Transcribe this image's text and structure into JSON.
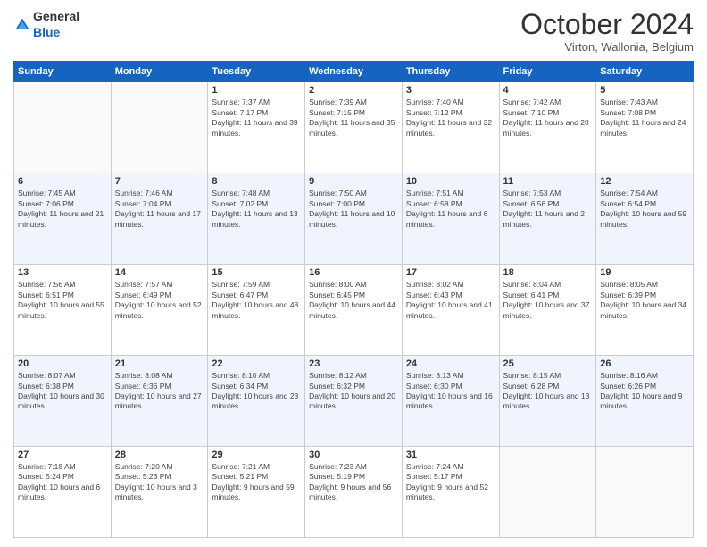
{
  "logo": {
    "text_general": "General",
    "text_blue": "Blue"
  },
  "header": {
    "month": "October 2024",
    "location": "Virton, Wallonia, Belgium"
  },
  "weekdays": [
    "Sunday",
    "Monday",
    "Tuesday",
    "Wednesday",
    "Thursday",
    "Friday",
    "Saturday"
  ],
  "weeks": [
    [
      {
        "day": "",
        "sunrise": "",
        "sunset": "",
        "daylight": ""
      },
      {
        "day": "",
        "sunrise": "",
        "sunset": "",
        "daylight": ""
      },
      {
        "day": "1",
        "sunrise": "Sunrise: 7:37 AM",
        "sunset": "Sunset: 7:17 PM",
        "daylight": "Daylight: 11 hours and 39 minutes."
      },
      {
        "day": "2",
        "sunrise": "Sunrise: 7:39 AM",
        "sunset": "Sunset: 7:15 PM",
        "daylight": "Daylight: 11 hours and 35 minutes."
      },
      {
        "day": "3",
        "sunrise": "Sunrise: 7:40 AM",
        "sunset": "Sunset: 7:12 PM",
        "daylight": "Daylight: 11 hours and 32 minutes."
      },
      {
        "day": "4",
        "sunrise": "Sunrise: 7:42 AM",
        "sunset": "Sunset: 7:10 PM",
        "daylight": "Daylight: 11 hours and 28 minutes."
      },
      {
        "day": "5",
        "sunrise": "Sunrise: 7:43 AM",
        "sunset": "Sunset: 7:08 PM",
        "daylight": "Daylight: 11 hours and 24 minutes."
      }
    ],
    [
      {
        "day": "6",
        "sunrise": "Sunrise: 7:45 AM",
        "sunset": "Sunset: 7:06 PM",
        "daylight": "Daylight: 11 hours and 21 minutes."
      },
      {
        "day": "7",
        "sunrise": "Sunrise: 7:46 AM",
        "sunset": "Sunset: 7:04 PM",
        "daylight": "Daylight: 11 hours and 17 minutes."
      },
      {
        "day": "8",
        "sunrise": "Sunrise: 7:48 AM",
        "sunset": "Sunset: 7:02 PM",
        "daylight": "Daylight: 11 hours and 13 minutes."
      },
      {
        "day": "9",
        "sunrise": "Sunrise: 7:50 AM",
        "sunset": "Sunset: 7:00 PM",
        "daylight": "Daylight: 11 hours and 10 minutes."
      },
      {
        "day": "10",
        "sunrise": "Sunrise: 7:51 AM",
        "sunset": "Sunset: 6:58 PM",
        "daylight": "Daylight: 11 hours and 6 minutes."
      },
      {
        "day": "11",
        "sunrise": "Sunrise: 7:53 AM",
        "sunset": "Sunset: 6:56 PM",
        "daylight": "Daylight: 11 hours and 2 minutes."
      },
      {
        "day": "12",
        "sunrise": "Sunrise: 7:54 AM",
        "sunset": "Sunset: 6:54 PM",
        "daylight": "Daylight: 10 hours and 59 minutes."
      }
    ],
    [
      {
        "day": "13",
        "sunrise": "Sunrise: 7:56 AM",
        "sunset": "Sunset: 6:51 PM",
        "daylight": "Daylight: 10 hours and 55 minutes."
      },
      {
        "day": "14",
        "sunrise": "Sunrise: 7:57 AM",
        "sunset": "Sunset: 6:49 PM",
        "daylight": "Daylight: 10 hours and 52 minutes."
      },
      {
        "day": "15",
        "sunrise": "Sunrise: 7:59 AM",
        "sunset": "Sunset: 6:47 PM",
        "daylight": "Daylight: 10 hours and 48 minutes."
      },
      {
        "day": "16",
        "sunrise": "Sunrise: 8:00 AM",
        "sunset": "Sunset: 6:45 PM",
        "daylight": "Daylight: 10 hours and 44 minutes."
      },
      {
        "day": "17",
        "sunrise": "Sunrise: 8:02 AM",
        "sunset": "Sunset: 6:43 PM",
        "daylight": "Daylight: 10 hours and 41 minutes."
      },
      {
        "day": "18",
        "sunrise": "Sunrise: 8:04 AM",
        "sunset": "Sunset: 6:41 PM",
        "daylight": "Daylight: 10 hours and 37 minutes."
      },
      {
        "day": "19",
        "sunrise": "Sunrise: 8:05 AM",
        "sunset": "Sunset: 6:39 PM",
        "daylight": "Daylight: 10 hours and 34 minutes."
      }
    ],
    [
      {
        "day": "20",
        "sunrise": "Sunrise: 8:07 AM",
        "sunset": "Sunset: 6:38 PM",
        "daylight": "Daylight: 10 hours and 30 minutes."
      },
      {
        "day": "21",
        "sunrise": "Sunrise: 8:08 AM",
        "sunset": "Sunset: 6:36 PM",
        "daylight": "Daylight: 10 hours and 27 minutes."
      },
      {
        "day": "22",
        "sunrise": "Sunrise: 8:10 AM",
        "sunset": "Sunset: 6:34 PM",
        "daylight": "Daylight: 10 hours and 23 minutes."
      },
      {
        "day": "23",
        "sunrise": "Sunrise: 8:12 AM",
        "sunset": "Sunset: 6:32 PM",
        "daylight": "Daylight: 10 hours and 20 minutes."
      },
      {
        "day": "24",
        "sunrise": "Sunrise: 8:13 AM",
        "sunset": "Sunset: 6:30 PM",
        "daylight": "Daylight: 10 hours and 16 minutes."
      },
      {
        "day": "25",
        "sunrise": "Sunrise: 8:15 AM",
        "sunset": "Sunset: 6:28 PM",
        "daylight": "Daylight: 10 hours and 13 minutes."
      },
      {
        "day": "26",
        "sunrise": "Sunrise: 8:16 AM",
        "sunset": "Sunset: 6:26 PM",
        "daylight": "Daylight: 10 hours and 9 minutes."
      }
    ],
    [
      {
        "day": "27",
        "sunrise": "Sunrise: 7:18 AM",
        "sunset": "Sunset: 5:24 PM",
        "daylight": "Daylight: 10 hours and 6 minutes."
      },
      {
        "day": "28",
        "sunrise": "Sunrise: 7:20 AM",
        "sunset": "Sunset: 5:23 PM",
        "daylight": "Daylight: 10 hours and 3 minutes."
      },
      {
        "day": "29",
        "sunrise": "Sunrise: 7:21 AM",
        "sunset": "Sunset: 5:21 PM",
        "daylight": "Daylight: 9 hours and 59 minutes."
      },
      {
        "day": "30",
        "sunrise": "Sunrise: 7:23 AM",
        "sunset": "Sunset: 5:19 PM",
        "daylight": "Daylight: 9 hours and 56 minutes."
      },
      {
        "day": "31",
        "sunrise": "Sunrise: 7:24 AM",
        "sunset": "Sunset: 5:17 PM",
        "daylight": "Daylight: 9 hours and 52 minutes."
      },
      {
        "day": "",
        "sunrise": "",
        "sunset": "",
        "daylight": ""
      },
      {
        "day": "",
        "sunrise": "",
        "sunset": "",
        "daylight": ""
      }
    ]
  ]
}
